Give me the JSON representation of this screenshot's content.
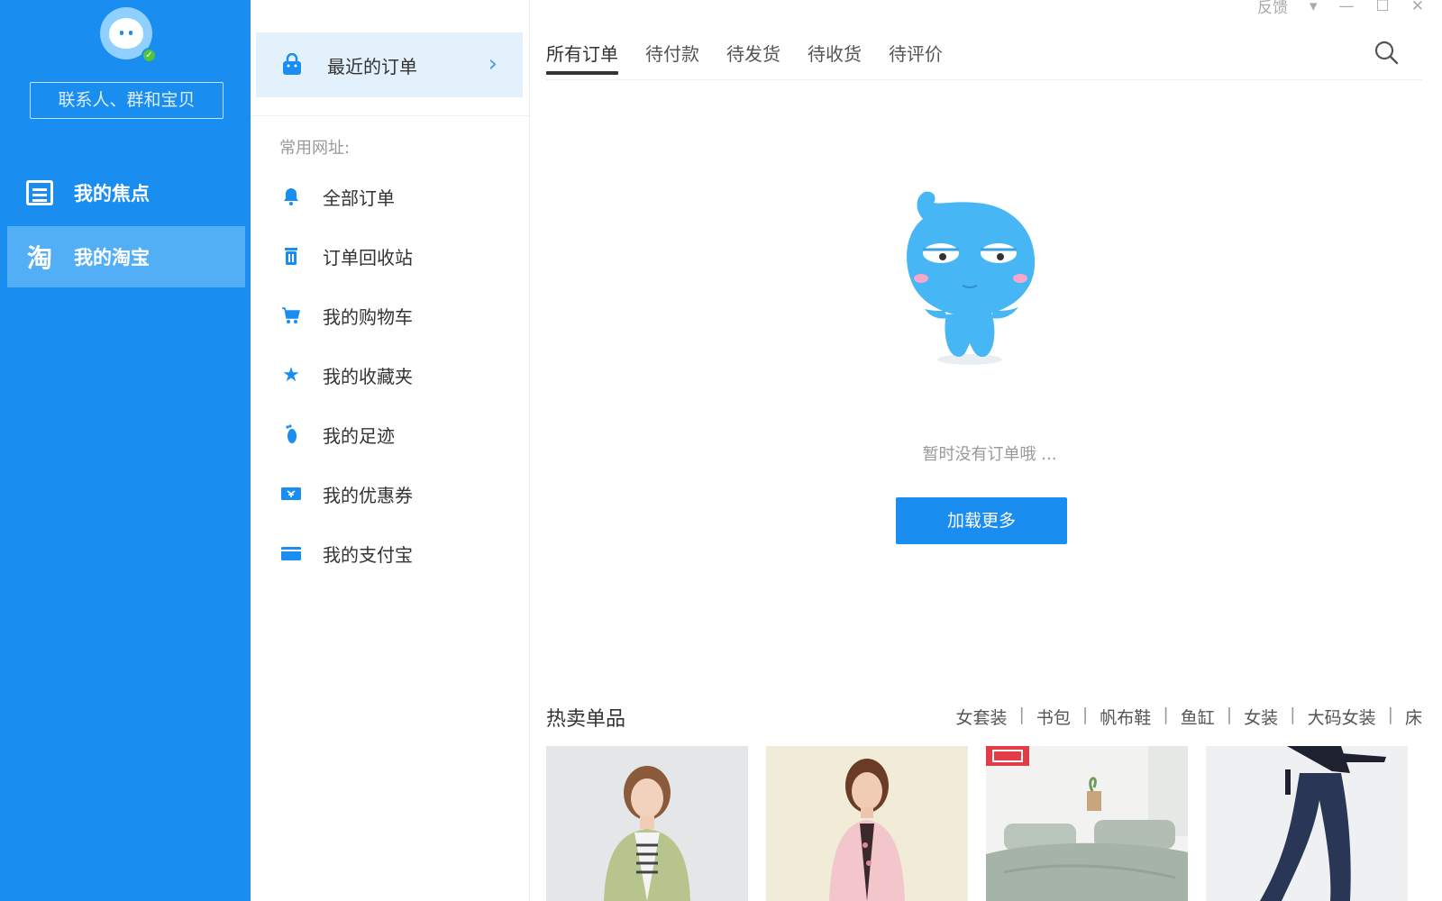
{
  "sidebar": {
    "search_placeholder": "联系人、群和宝贝",
    "items": [
      {
        "label": "我的焦点",
        "icon": "focus-icon"
      },
      {
        "label": "我的淘宝",
        "icon": "taobao-icon",
        "active": true
      }
    ]
  },
  "middle": {
    "recent_orders": "最近的订单",
    "common_label": "常用网址:",
    "links": [
      {
        "label": "全部订单",
        "icon": "bell-icon"
      },
      {
        "label": "订单回收站",
        "icon": "trash-icon"
      },
      {
        "label": "我的购物车",
        "icon": "cart-icon"
      },
      {
        "label": "我的收藏夹",
        "icon": "star-icon"
      },
      {
        "label": "我的足迹",
        "icon": "footprint-icon"
      },
      {
        "label": "我的优惠券",
        "icon": "coupon-icon"
      },
      {
        "label": "我的支付宝",
        "icon": "wallet-icon"
      }
    ]
  },
  "window": {
    "feedback": "反馈"
  },
  "main": {
    "tabs": [
      "所有订单",
      "待付款",
      "待发货",
      "待收货",
      "待评价"
    ],
    "empty_text": "暂时没有订单哦 ...",
    "load_more": "加载更多",
    "hot_title": "热卖单品",
    "hot_categories": [
      "女套装",
      "书包",
      "帆布鞋",
      "鱼缸",
      "女装",
      "大码女装",
      "床"
    ]
  },
  "colors": {
    "brand_blue": "#1a8df0",
    "active_item": "#52aef5",
    "recent_bg": "#e3f1fd"
  }
}
